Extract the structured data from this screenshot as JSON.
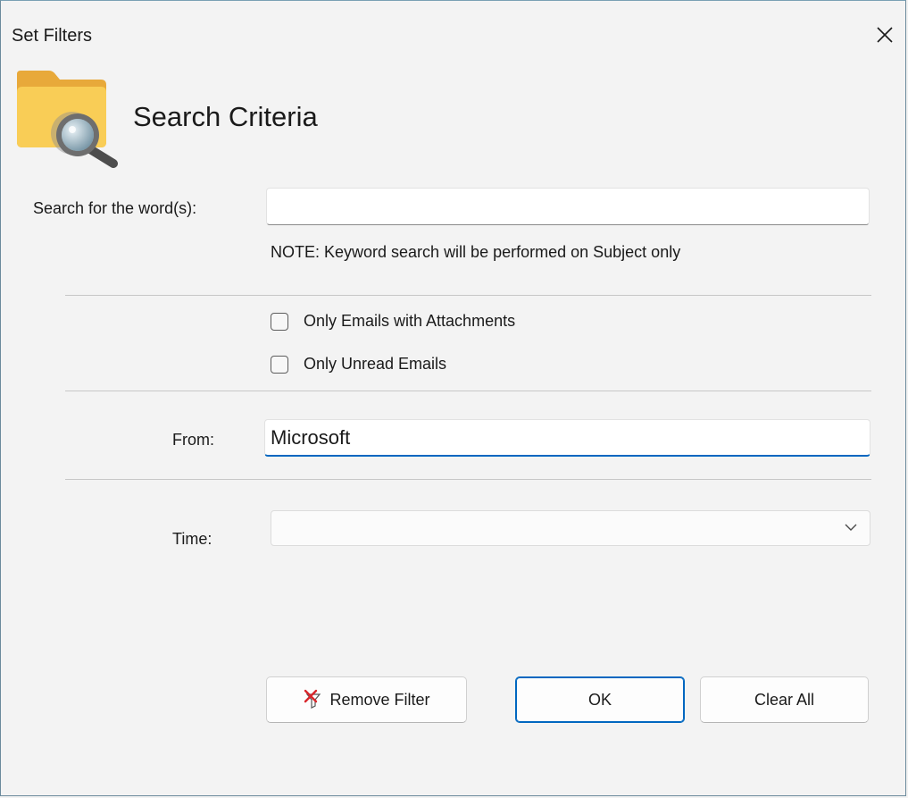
{
  "window": {
    "title": "Set Filters"
  },
  "header": {
    "title": "Search Criteria",
    "icon": "folder-search-icon"
  },
  "search": {
    "label": "Search for the word(s):",
    "value": "",
    "placeholder": "",
    "note": "NOTE: Keyword search will be performed on Subject only"
  },
  "options": {
    "attachments_label": "Only Emails with Attachments",
    "attachments_checked": false,
    "unread_label": "Only Unread Emails",
    "unread_checked": false
  },
  "from": {
    "label": "From:",
    "value": "Microsoft"
  },
  "time": {
    "label": "Time:",
    "value": ""
  },
  "buttons": {
    "remove_filter": "Remove Filter",
    "ok": "OK",
    "clear_all": "Clear All"
  },
  "colors": {
    "accent": "#0067c0",
    "folder": "#f7c548",
    "background": "#f3f3f3"
  }
}
